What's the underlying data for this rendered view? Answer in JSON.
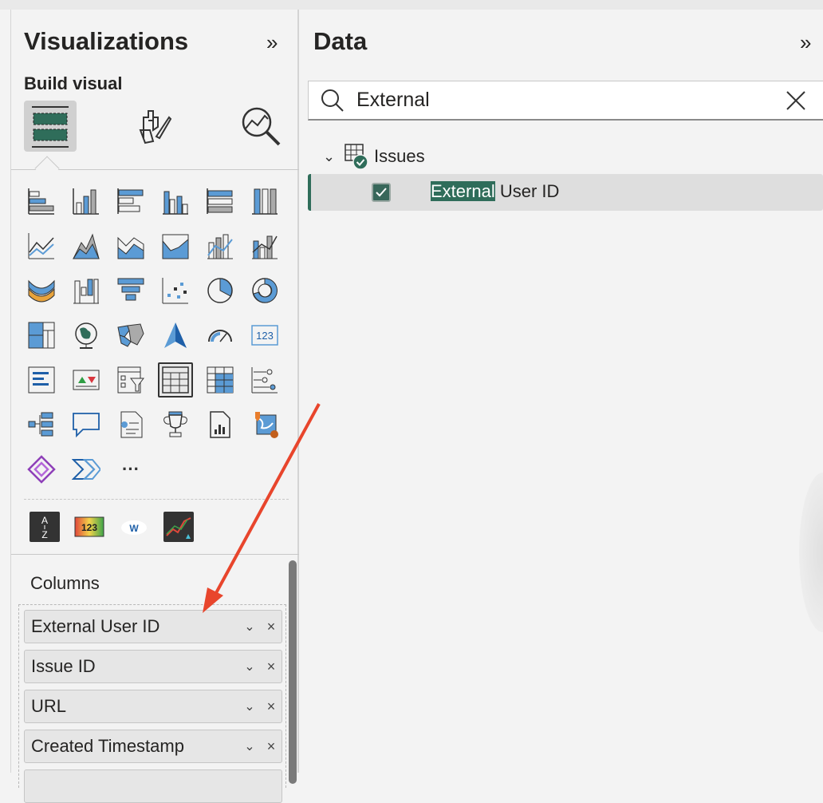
{
  "visualizations": {
    "title": "Visualizations",
    "collapse_glyph": "»",
    "build_visual_label": "Build visual",
    "tabs": [
      {
        "name": "build-visual-tab",
        "icon": "table-visual-icon",
        "active": true
      },
      {
        "name": "format-visual-tab",
        "icon": "paintbrush-icon",
        "active": false
      },
      {
        "name": "analytics-tab",
        "icon": "analytics-magnifier-icon",
        "active": false
      }
    ],
    "more_visuals_glyph": "···",
    "columns_label": "Columns",
    "columns": [
      {
        "label": "External User ID"
      },
      {
        "label": "Issue ID"
      },
      {
        "label": "URL"
      },
      {
        "label": "Created Timestamp"
      }
    ],
    "custom_visuals": {
      "az_top": "A",
      "az_bottom": "Z",
      "num_label": "123",
      "word_label": "W"
    },
    "card_label": "123"
  },
  "data": {
    "title": "Data",
    "collapse_glyph": "»",
    "search_value": "External",
    "table_name": "Issues",
    "field_match": "External",
    "field_rest": " User ID",
    "field_checked": true
  },
  "colors": {
    "accent": "#2f6d5a",
    "viz_blue": "#5b9bd5",
    "annotation_arrow": "#e8452c"
  }
}
